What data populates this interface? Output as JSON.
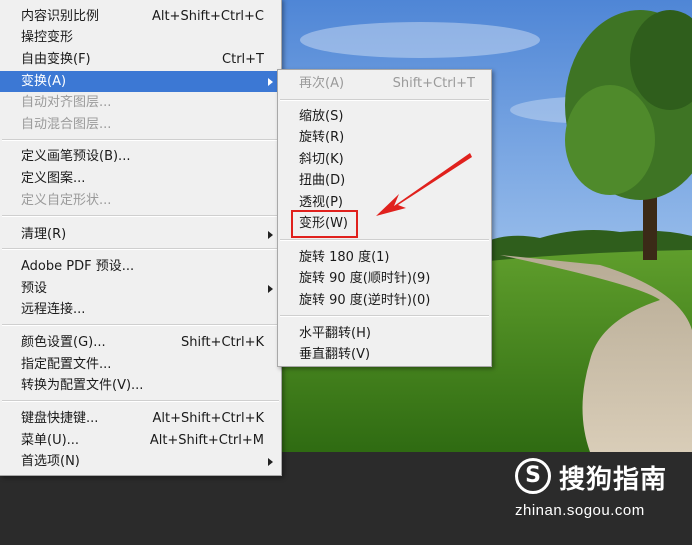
{
  "main_menu": {
    "items": [
      {
        "label": "内容识别比例",
        "shortcut": "Alt+Shift+Ctrl+C"
      },
      {
        "label": "操控变形",
        "shortcut": ""
      },
      {
        "label": "自由变换(F)",
        "shortcut": "Ctrl+T"
      },
      {
        "label": "变换(A)",
        "shortcut": ""
      },
      {
        "label": "自动对齐图层...",
        "shortcut": ""
      },
      {
        "label": "自动混合图层...",
        "shortcut": ""
      },
      {
        "label": "定义画笔预设(B)...",
        "shortcut": ""
      },
      {
        "label": "定义图案...",
        "shortcut": ""
      },
      {
        "label": "定义自定形状...",
        "shortcut": ""
      },
      {
        "label": "清理(R)",
        "shortcut": ""
      },
      {
        "label": "Adobe PDF 预设...",
        "shortcut": ""
      },
      {
        "label": "预设",
        "shortcut": ""
      },
      {
        "label": "远程连接...",
        "shortcut": ""
      },
      {
        "label": "颜色设置(G)...",
        "shortcut": "Shift+Ctrl+K"
      },
      {
        "label": "指定配置文件...",
        "shortcut": ""
      },
      {
        "label": "转换为配置文件(V)...",
        "shortcut": ""
      },
      {
        "label": "键盘快捷键...",
        "shortcut": "Alt+Shift+Ctrl+K"
      },
      {
        "label": "菜单(U)...",
        "shortcut": "Alt+Shift+Ctrl+M"
      },
      {
        "label": "首选项(N)",
        "shortcut": ""
      }
    ]
  },
  "transform_submenu": {
    "items": [
      {
        "label": "再次(A)",
        "shortcut": "Shift+Ctrl+T"
      },
      {
        "label": "缩放(S)"
      },
      {
        "label": "旋转(R)"
      },
      {
        "label": "斜切(K)"
      },
      {
        "label": "扭曲(D)"
      },
      {
        "label": "透视(P)"
      },
      {
        "label": "变形(W)"
      },
      {
        "label": "旋转 180 度(1)"
      },
      {
        "label": "旋转 90 度(顺时针)(9)"
      },
      {
        "label": "旋转 90 度(逆时针)(0)"
      },
      {
        "label": "水平翻转(H)"
      },
      {
        "label": "垂直翻转(V)"
      }
    ]
  },
  "watermark": {
    "logo_letter": "S",
    "name": "搜狗指南",
    "url": "zhinan.sogou.com"
  },
  "colors": {
    "highlight": "#3c78d4",
    "annotation_red": "#e0211d",
    "menu_bg": "#f0f0f0"
  }
}
